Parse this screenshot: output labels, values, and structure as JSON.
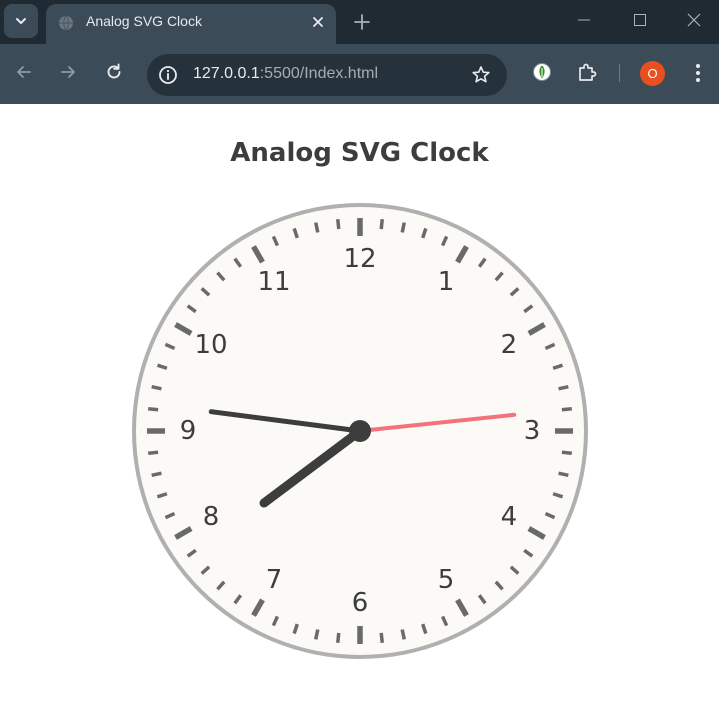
{
  "browser": {
    "tab_title": "Analog SVG Clock",
    "url_host": "127.0.0.1",
    "url_path": ":5500/Index.html",
    "profile_initial": "O",
    "icons": {
      "tab_search": "chevron-down-icon",
      "favicon": "globe-icon",
      "tab_close": "close-icon",
      "new_tab": "plus-icon",
      "minimize": "minimize-icon",
      "maximize": "maximize-icon",
      "window_close": "close-icon",
      "back": "arrow-left-icon",
      "forward": "arrow-right-icon",
      "reload": "reload-icon",
      "site_info": "info-icon",
      "bookmark": "star-icon",
      "extension_1": "leaf-shield-icon",
      "extensions": "puzzle-icon",
      "menu": "kebab-menu-icon"
    }
  },
  "page": {
    "heading": "Analog SVG Clock"
  },
  "clock": {
    "numerals": [
      "12",
      "1",
      "2",
      "3",
      "4",
      "5",
      "6",
      "7",
      "8",
      "9",
      "10",
      "11"
    ],
    "time": {
      "hours": 7,
      "minutes": 46,
      "seconds": 14
    },
    "colors": {
      "face": "#fcfaf7",
      "rim": "#b0b0b0",
      "ticks": "#6a6a6a",
      "numerals": "#3d3d3d",
      "hour_hand": "#3d3d3d",
      "minute_hand": "#3d3d3d",
      "second_hand": "#f4737a",
      "center": "#3d3d3d"
    }
  }
}
